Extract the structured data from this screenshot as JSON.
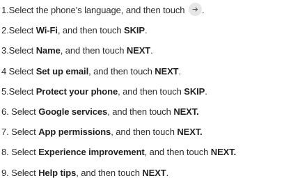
{
  "steps": [
    {
      "num": "1.",
      "pre": "Select the phone’s language, and then touch",
      "bold": "",
      "mid": "",
      "action": "",
      "end": ".",
      "icon": "right-arrow-icon"
    },
    {
      "num": "2.",
      "pre": "Select ",
      "bold": "Wi-Fi",
      "mid": ", and then touch ",
      "action": "SKIP",
      "end": "."
    },
    {
      "num": "3.",
      "pre": "Select ",
      "bold": "Name",
      "mid": ", and then touch ",
      "action": "NEXT",
      "end": "."
    },
    {
      "num": "4",
      "pre": " Select ",
      "bold": "Set up email",
      "mid": ", and then touch ",
      "action": "NEXT",
      "end": "."
    },
    {
      "num": "5.",
      "pre": "Select ",
      "bold": "Protect your phone",
      "mid": ", and then touch ",
      "action": "SKIP",
      "end": "."
    },
    {
      "num": "6.",
      "pre": " Select ",
      "bold": "Google services",
      "mid": ", and then touch ",
      "action": "NEXT.",
      "end": ""
    },
    {
      "num": "7.",
      "pre": " Select ",
      "bold": "App permissions",
      "mid": ", and then touch ",
      "action": "NEXT.",
      "end": ""
    },
    {
      "num": "8.",
      "pre": " Select ",
      "bold": "Experience improvement",
      "mid": ", and then touch ",
      "action": "NEXT.",
      "end": ""
    },
    {
      "num": "9.",
      "pre": " Select ",
      "bold": "Help tips",
      "mid": ", and then touch ",
      "action": "NEXT",
      "end": "."
    }
  ]
}
